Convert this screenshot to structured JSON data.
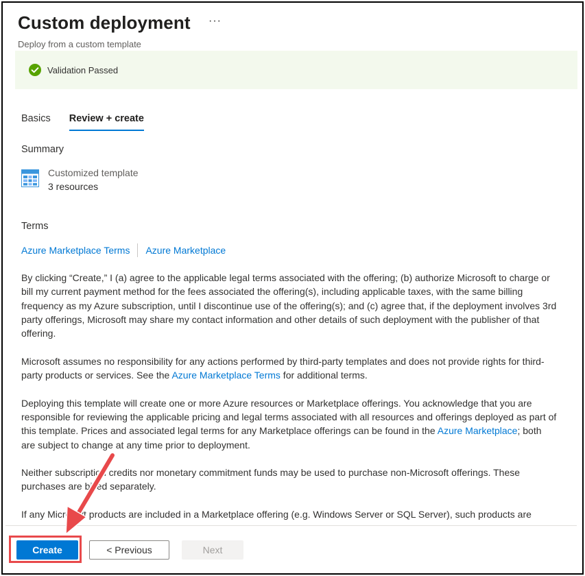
{
  "header": {
    "title": "Custom deployment",
    "more_label": "···",
    "subtitle": "Deploy from a custom template"
  },
  "validation": {
    "text": "Validation Passed",
    "icon": "check-circle-icon",
    "color": "#57a300",
    "background": "#f3f9ed"
  },
  "tabs": [
    {
      "label": "Basics",
      "active": false
    },
    {
      "label": "Review + create",
      "active": true
    }
  ],
  "summary": {
    "heading": "Summary",
    "template_name": "Customized template",
    "resource_count": "3 resources",
    "icon": "template-grid-icon"
  },
  "terms": {
    "heading": "Terms",
    "link1": "Azure Marketplace Terms",
    "link2": "Azure Marketplace",
    "p1": "By clicking “Create,” I (a) agree to the applicable legal terms associated with the offering; (b) authorize Microsoft to charge or bill my current payment method for the fees associated the offering(s), including applicable taxes, with the same billing frequency as my Azure subscription, until I discontinue use of the offering(s); and (c) agree that, if the deployment involves 3rd party offerings, Microsoft may share my contact information and other details of such deployment with the publisher of that offering.",
    "p2_a": "Microsoft assumes no responsibility for any actions performed by third-party templates and does not provide rights for third-party products or services. See the ",
    "p2_link": "Azure Marketplace Terms",
    "p2_b": " for additional terms.",
    "p3_a": "Deploying this template will create one or more Azure resources or Marketplace offerings.  You acknowledge that you are responsible for reviewing the applicable pricing and legal terms associated with all resources and offerings deployed as part of this template.  Prices and associated legal terms for any Marketplace offerings can be found in the ",
    "p3_link": "Azure Marketplace",
    "p3_b": "; both are subject to change at any time prior to deployment.",
    "p4": "Neither subscription credits nor monetary commitment funds may be used to purchase non-Microsoft offerings. These purchases are billed separately.",
    "p5": "If any Microsoft products are included in a Marketplace offering (e.g. Windows Server or SQL Server), such products are licensed by Microsoft and not by any third party."
  },
  "footer": {
    "create_label": "Create",
    "previous_label": "< Previous",
    "next_label": "Next"
  },
  "colors": {
    "accent": "#0078d4",
    "annotation": "#e8494b"
  }
}
